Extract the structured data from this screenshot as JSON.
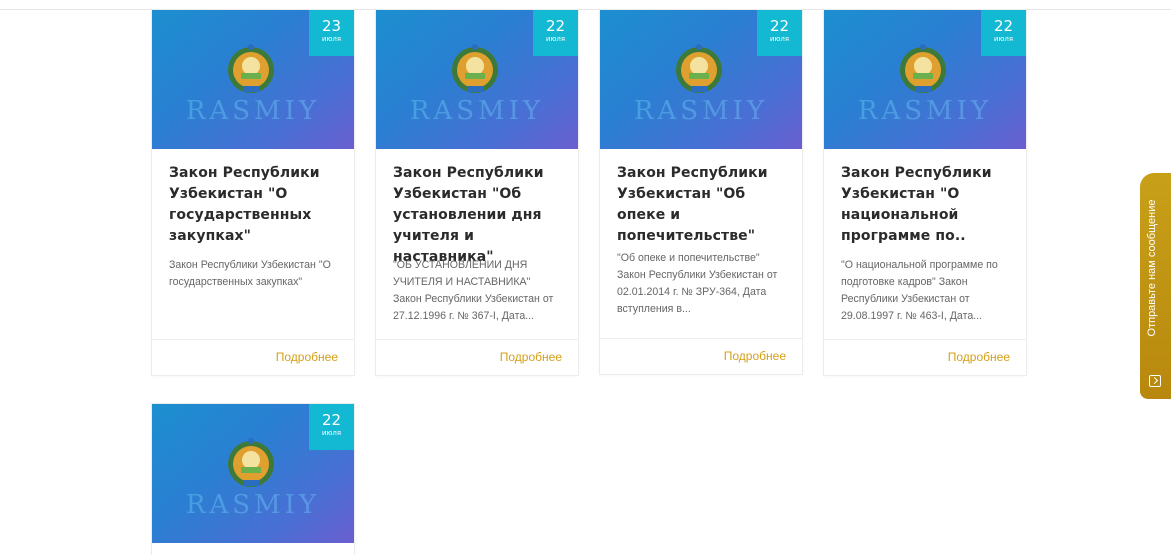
{
  "posts": [
    {
      "day": "23",
      "month": "июля",
      "image_text": "RASMIY",
      "title": "Закон Республики Узбекистан \"О государственных закупках\"",
      "excerpt": "Закон Республики Узбекистан \"О государственных закупках\"",
      "more": "Подробнее"
    },
    {
      "day": "22",
      "month": "июля",
      "image_text": "RASMIY",
      "title": "Закон Республики Узбекистан \"Об установлении дня учителя и наставника\"",
      "excerpt": "\"ОБ УСТАНОВЛЕНИИ ДНЯ УЧИТЕЛЯ И НАСТАВНИКА\" Закон Республики Узбекистан от 27.12.1996 г. № 367-I, Дата...",
      "more": "Подробнее"
    },
    {
      "day": "22",
      "month": "июля",
      "image_text": "RASMIY",
      "title": "Закон Республики Узбекистан \"Об опеке и попечительстве\"",
      "excerpt": "\"Об опеке и попечительстве\" Закон Республики Узбекистан от 02.01.2014 г. № ЗРУ-364, Дата вступления в...",
      "more": "Подробнее"
    },
    {
      "day": "22",
      "month": "июля",
      "image_text": "RASMIY",
      "title": "Закон Республики Узбекистан \"О национальной программе по..",
      "excerpt": "\"О национальной программе по подготовке кадров\" Закон Республики Узбекистан от 29.08.1997 г. № 463-I, Дата...",
      "more": "Подробнее"
    },
    {
      "day": "22",
      "month": "июля",
      "image_text": "RASMIY"
    }
  ],
  "feedback_tab": {
    "label": "Отправьте нам сообщение",
    "icon": "message-icon",
    "color": "#c09010"
  },
  "colors": {
    "date_badge": "#13b8d2",
    "more_link": "#d4a017"
  }
}
